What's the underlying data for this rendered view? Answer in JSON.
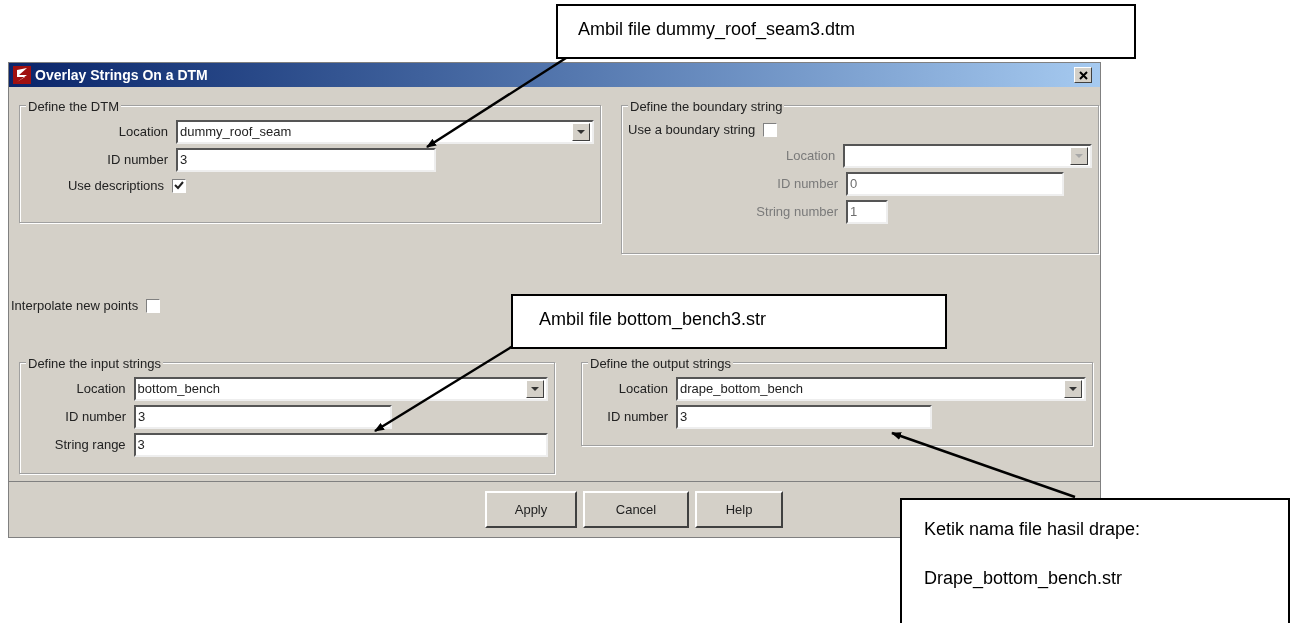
{
  "window": {
    "title": "Overlay Strings On a DTM"
  },
  "groups": [
    {
      "title": "Define the DTM",
      "fields": [
        {
          "kind": "dropdown",
          "label": "Location",
          "value": "dummy_roof_seam",
          "disabled": false
        },
        {
          "kind": "text",
          "label": "ID number",
          "value": "3",
          "disabled": false
        },
        {
          "kind": "checkbox",
          "label": "Use descriptions",
          "checked": true,
          "disabled": false
        }
      ]
    },
    {
      "title": "Define the boundary string",
      "fields": [
        {
          "kind": "checkbox",
          "label": "Use a boundary string",
          "checked": false,
          "disabled": false
        },
        {
          "kind": "dropdown",
          "label": "Location",
          "disabled": true
        },
        {
          "kind": "text",
          "label": "ID number",
          "value": "0",
          "disabled": true
        },
        {
          "kind": "text",
          "label": "String number",
          "value": "1",
          "disabled": true
        }
      ]
    },
    {
      "title": "Define the input strings",
      "fields": [
        {
          "kind": "dropdown",
          "label": "Location",
          "value": "bottom_bench",
          "disabled": false
        },
        {
          "kind": "text",
          "label": "ID number",
          "value": "3",
          "disabled": false
        },
        {
          "kind": "text",
          "label": "String range",
          "value": "3",
          "disabled": false
        }
      ]
    },
    {
      "title": "Define the output strings",
      "fields": [
        {
          "kind": "dropdown",
          "label": "Location",
          "value": "drape_bottom_bench",
          "disabled": false
        },
        {
          "kind": "text",
          "label": "ID number",
          "value": "3",
          "disabled": false
        }
      ]
    }
  ],
  "interpolate": {
    "label": "Interpolate new points",
    "checked": false
  },
  "buttons": [
    "Apply",
    "Cancel",
    "Help"
  ],
  "callouts": [
    {
      "lines": [
        "Ambil file dummy_roof_seam3.dtm"
      ]
    },
    {
      "lines": [
        "Ambil file bottom_bench3.str"
      ]
    },
    {
      "lines": [
        "Ketik nama file hasil drape:",
        "Drape_bottom_bench.str"
      ]
    }
  ]
}
